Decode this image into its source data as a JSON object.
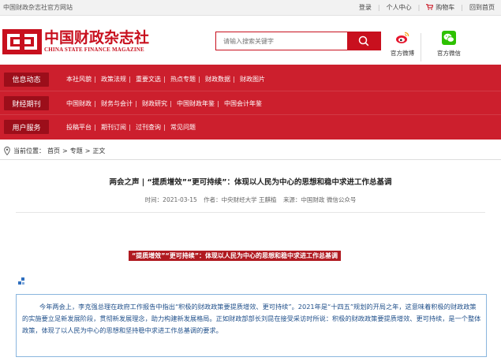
{
  "topbar": {
    "site_name": "中国财政杂志社官方网站",
    "login": "登录",
    "user_center": "个人中心",
    "cart": "购物车",
    "home": "回到首页"
  },
  "header": {
    "logo_cn": "中国财政杂志社",
    "logo_en": "CHINA STATE FINANCE MAGAZINE",
    "search_placeholder": "请输入搜索关键字",
    "weibo_label": "官方微博",
    "wechat_label": "官方微信"
  },
  "nav": {
    "rows": [
      {
        "head": "信息动态",
        "items": [
          "本社风貌",
          "政策法规",
          "重要文选",
          "热点专题",
          "财政数据",
          "财政图片"
        ]
      },
      {
        "head": "财经期刊",
        "items": [
          "中国财政",
          "财务与会计",
          "财政研究",
          "中国财政年鉴",
          "中国会计年鉴"
        ]
      },
      {
        "head": "用户服务",
        "items": [
          "投稿平台",
          "期刊订阅",
          "过刊查询",
          "常见问题"
        ]
      }
    ]
  },
  "breadcrumb": {
    "label": "当前位置：",
    "home": "首页",
    "sep1": ">",
    "topic": "专题",
    "sep2": ">",
    "current": "正文"
  },
  "article": {
    "title": "两会之声 | “提质增效”“更可持续”：体现以人民为中心的思想和稳中求进工作总基调",
    "time": "时间：2021-03-15",
    "author": "作者：中央财经大学 王麒植",
    "source": "来源：中国财政 微信公众号",
    "banner": "“提质增效”“更可持续”：体现以人民为中心的思想和稳中求进工作总基调",
    "paragraph": "今年两会上，李克强总理在政府工作报告中指出“积极的财政政策要提质增效、更可持续”。2021年是“十四五”规划的开局之年，这意味着积极的财政政策的实施要立足新发展阶段，贯彻新发展理念，助力构建新发展格局。正如财政部部长刘昆在接受采访时所说：积极的财政政策要提质增效、更可持续，是一个整体政策，体现了以人民为中心的思想和坚持稳中求进工作总基调的要求。"
  },
  "colors": {
    "brand_red": "#c8101e",
    "nav_red": "#cc1f2d",
    "nav_head": "#9c0e1a",
    "text_blue": "#1f4f8a",
    "box_border": "#8ab6de"
  }
}
